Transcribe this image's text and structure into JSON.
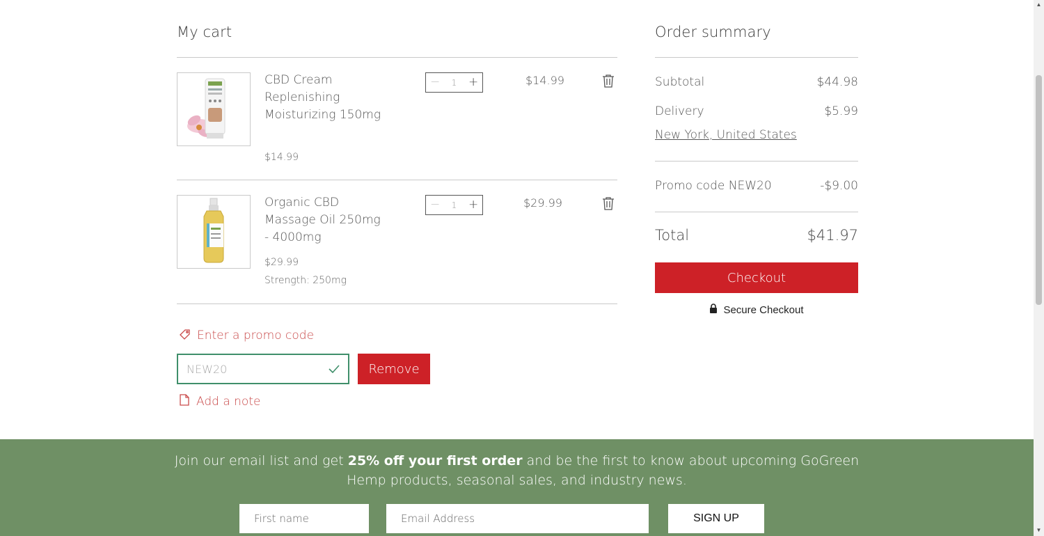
{
  "cart": {
    "title": "My cart",
    "items": [
      {
        "name": "CBD Cream Replenishing Moisturizing 150mg",
        "unit_price": "$14.99",
        "option": "",
        "quantity": "1",
        "line_total": "$14.99"
      },
      {
        "name": "Organic CBD Massage Oil 250mg - 4000mg",
        "unit_price": "$29.99",
        "option": "Strength: 250mg",
        "quantity": "1",
        "line_total": "$29.99"
      }
    ],
    "promo_link": "Enter a promo code",
    "promo_value": "NEW20",
    "remove_label": "Remove",
    "note_link": "Add a note"
  },
  "summary": {
    "title": "Order summary",
    "subtotal_label": "Subtotal",
    "subtotal_value": "$44.98",
    "delivery_label": "Delivery",
    "delivery_value": "$5.99",
    "location": "New York, United States",
    "promo_label": "Promo code NEW20",
    "promo_value": "-$9.00",
    "total_label": "Total",
    "total_value": "$41.97",
    "checkout_label": "Checkout",
    "secure_label": "Secure Checkout"
  },
  "footer": {
    "text_before": "Join our email list and get ",
    "text_bold": "25% off your first order",
    "text_after": " and be the first to know about upcoming GoGreen Hemp products, seasonal sales, and industry news.",
    "first_name_placeholder": "First name",
    "email_placeholder": "Email Address",
    "signup_label": "SIGN UP"
  },
  "colors": {
    "accent_red": "#cd2127",
    "footer_green": "#6f9065",
    "promo_valid_green": "#3f8f6a"
  }
}
